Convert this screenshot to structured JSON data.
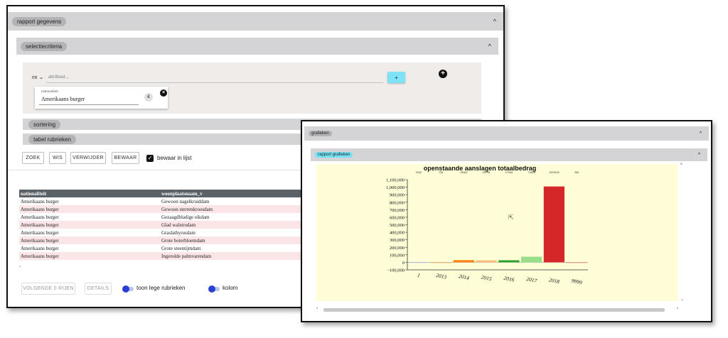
{
  "main_window": {
    "rapport_label": "rapport gegevens",
    "criteria_label": "selectiecriteria",
    "operator": "en",
    "attribute_placeholder": "attribuut...",
    "add_button_label": "+",
    "criterion": {
      "field_label": "nationaliteit",
      "value": "Amerikaans burger",
      "edit_symbol": "€"
    },
    "sortering_label": "sortering",
    "tabel_rubrieken_label": "tabel rubrieken",
    "buttons": {
      "zoek": "ZOEK",
      "wis": "WIS",
      "verwijder": "VERWIJDER",
      "bewaar": "BEWAAR"
    },
    "bewaar_in_lijst": "bewaar in lijst",
    "table": {
      "columns": [
        "nationaliteit",
        "woonplaatsnaam_v"
      ],
      "rows": [
        [
          "Amerikaans burger",
          "Gewoon nagelkruiddam"
        ],
        [
          "Amerikaans burger",
          "Gewoon sterrenkroosdam"
        ],
        [
          "Amerikaans burger",
          "Gezaagdbladige eikdam"
        ],
        [
          "Amerikaans burger",
          "Glad walstrodam"
        ],
        [
          "Amerikaans burger",
          "Graslathyrusdam"
        ],
        [
          "Amerikaans burger",
          "Grote boterbloemdam"
        ],
        [
          "Amerikaans burger",
          "Grote steentijmdam"
        ],
        [
          "Amerikaans burger",
          "Ingerolde palmvarendam"
        ]
      ]
    },
    "footer": {
      "volgende": "VOLGENDE 0 RIJEN",
      "details": "DETAILS",
      "toon_lege": "toon lege rubrieken",
      "kolom": "kolom"
    }
  },
  "chart_window": {
    "grafieken_label": "grafieken",
    "rapport_grafieken_label": "rapport grafieken"
  },
  "chart_data": {
    "type": "bar",
    "title": "openstaande aanslagen totaalbedrag",
    "categories": [
      "1",
      "2013",
      "2014",
      "2015",
      "2016",
      "2017",
      "2018",
      "9999"
    ],
    "values": [
      2032,
      251,
      29082,
      25746,
      27549,
      74605,
      1009118,
      284
    ],
    "value_labels": [
      "2032",
      "251",
      "29082",
      "25746",
      "27549",
      "74605",
      "1009118",
      "284"
    ],
    "colors": [
      "#aec7e8",
      "#ffbb78",
      "#ff7f0e",
      "#ffbb78",
      "#2ca02c",
      "#98df8a",
      "#d62728",
      "#ff9896"
    ],
    "ylim": [
      -100000,
      1100000
    ],
    "yticks": [
      -100000,
      0,
      100000,
      200000,
      300000,
      400000,
      500000,
      600000,
      700000,
      800000,
      900000,
      1000000,
      1100000
    ],
    "ytick_labels": [
      "−100,000",
      "0",
      "100,000",
      "200,000",
      "300,000",
      "400,000",
      "500,000",
      "600,000",
      "700,000",
      "800,000",
      "900,000",
      "1,000,000",
      "1,100,000"
    ],
    "background": "#fffed6"
  }
}
